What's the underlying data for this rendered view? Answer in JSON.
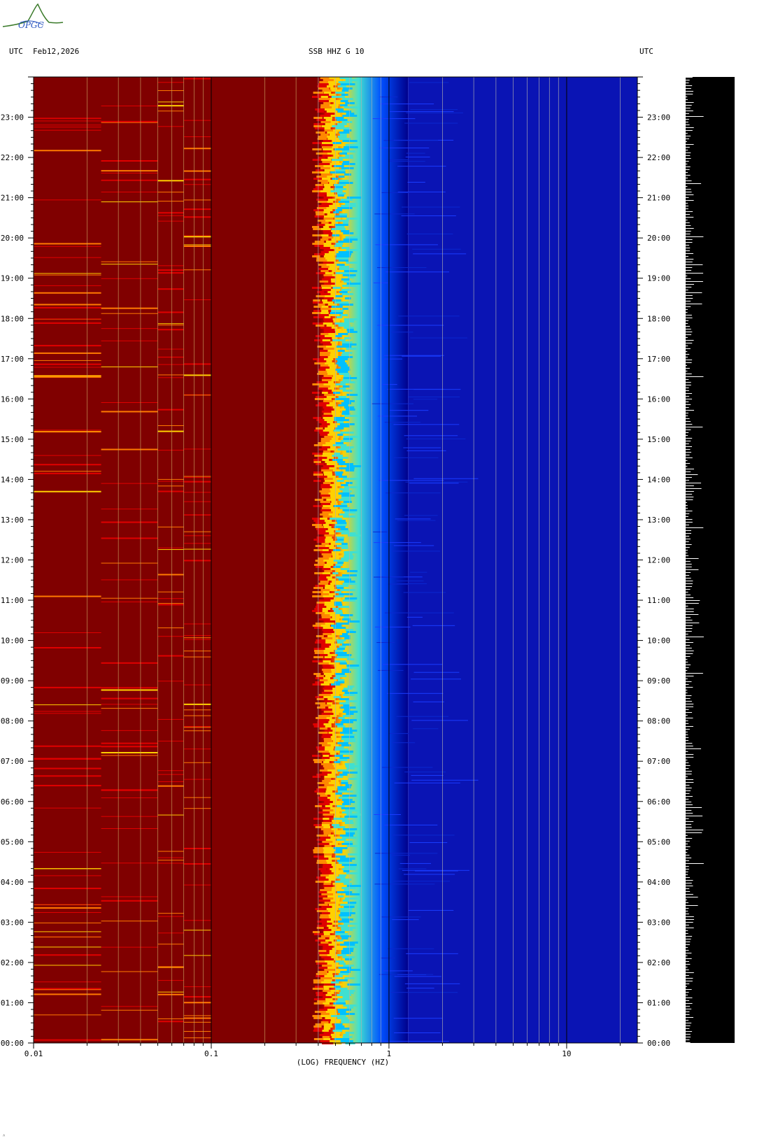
{
  "logo": {
    "text": "OPGC",
    "color": "#3a7a2a"
  },
  "header": {
    "left_timezone": "UTC",
    "date": "Feb12,2026",
    "station": "SSB HHZ G 10",
    "right_timezone": "UTC"
  },
  "footer_mark": "˄",
  "chart_data": {
    "type": "heatmap",
    "title": "SSB HHZ G 10",
    "xlabel": "(LOG) FREQUENCY (HZ)",
    "x_scale": "log",
    "xlim": [
      0.01,
      25
    ],
    "x_ticks": [
      {
        "value": 0.01,
        "label": "0.01"
      },
      {
        "value": 0.1,
        "label": "0.1"
      },
      {
        "value": 1,
        "label": "1"
      },
      {
        "value": 10,
        "label": "10"
      }
    ],
    "ylabel": "UTC",
    "ylim": [
      "00:00",
      "24:00"
    ],
    "y_ticks": [
      "00:00",
      "01:00",
      "02:00",
      "03:00",
      "04:00",
      "05:00",
      "06:00",
      "07:00",
      "08:00",
      "09:00",
      "10:00",
      "11:00",
      "12:00",
      "13:00",
      "14:00",
      "15:00",
      "16:00",
      "17:00",
      "18:00",
      "19:00",
      "20:00",
      "21:00",
      "22:00",
      "23:00"
    ],
    "colormap": [
      "#800000",
      "#e00000",
      "#ffd000",
      "#40e0d0",
      "#0040ff",
      "#00008c"
    ],
    "colors": {
      "high_power": "#800000",
      "transition": "#ffd000",
      "mid": "#40e0d0",
      "low_power": "#00008c"
    },
    "transition_band_hz": [
      0.4,
      0.8
    ],
    "gridline_freqs_hz": [
      0.02,
      0.03,
      0.04,
      0.05,
      0.06,
      0.07,
      0.08,
      0.09,
      0.2,
      0.3,
      0.4,
      0.5,
      0.6,
      0.7,
      0.8,
      0.9,
      2,
      3,
      4,
      5,
      6,
      7,
      8,
      9,
      20
    ],
    "trace_panel": {
      "background": "#000000",
      "trace_color": "#ffffff"
    }
  }
}
